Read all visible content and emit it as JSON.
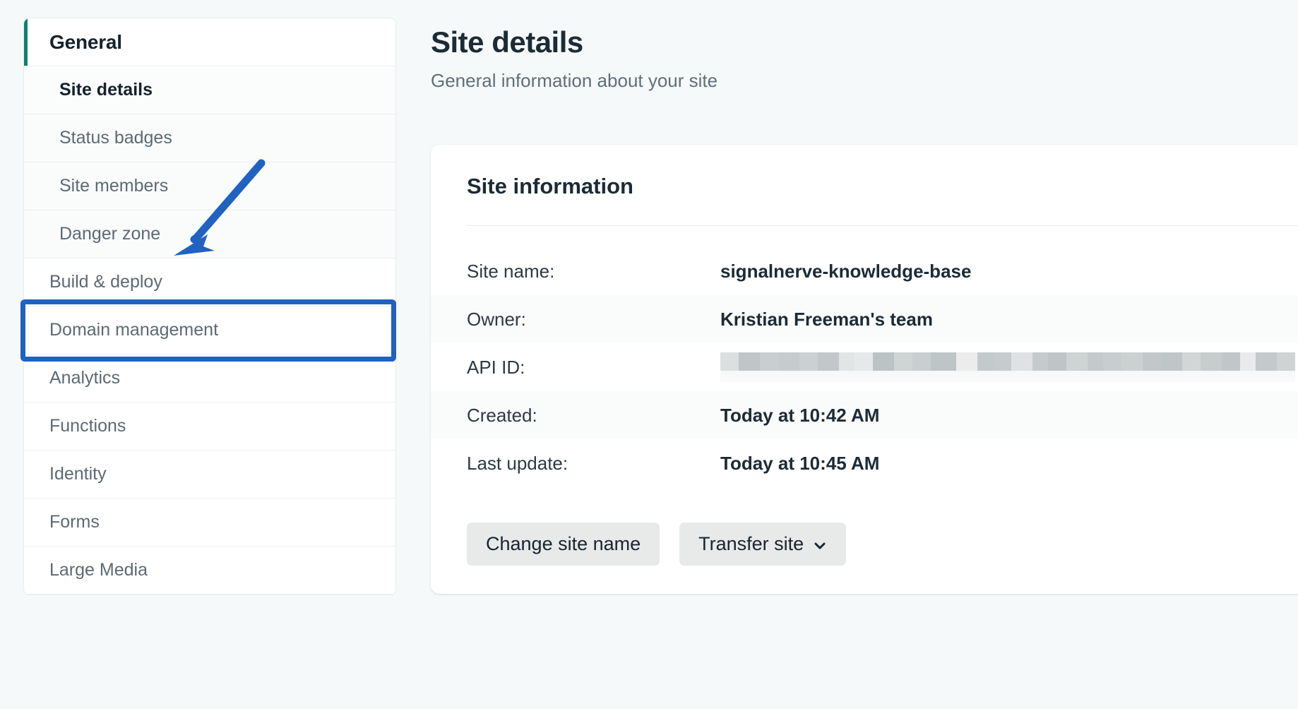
{
  "sidebar": {
    "header": {
      "label": "General",
      "accent_color": "#0e806f"
    },
    "subitems": [
      {
        "label": "Site details",
        "active": true
      },
      {
        "label": "Status badges",
        "active": false
      },
      {
        "label": "Site members",
        "active": false
      },
      {
        "label": "Danger zone",
        "active": false
      }
    ],
    "items": [
      {
        "label": "Build & deploy",
        "highlighted": true
      },
      {
        "label": "Domain management",
        "highlighted": false
      },
      {
        "label": "Analytics",
        "highlighted": false
      },
      {
        "label": "Functions",
        "highlighted": false
      },
      {
        "label": "Identity",
        "highlighted": false
      },
      {
        "label": "Forms",
        "highlighted": false
      },
      {
        "label": "Large Media",
        "highlighted": false
      }
    ]
  },
  "annotation": {
    "highlight_color": "#1f62c0",
    "arrow_color": "#1f62c0",
    "target": "Build & deploy"
  },
  "main": {
    "title": "Site details",
    "subtitle": "General information about your site",
    "card": {
      "title": "Site information",
      "rows": [
        {
          "key": "Site name:",
          "value": "signalnerve-knowledge-base",
          "redacted": false
        },
        {
          "key": "Owner:",
          "value": "Kristian Freeman's team",
          "redacted": false
        },
        {
          "key": "API ID:",
          "value": "",
          "redacted": true
        },
        {
          "key": "Created:",
          "value": "Today at 10:42 AM",
          "redacted": false
        },
        {
          "key": "Last update:",
          "value": "Today at 10:45 AM",
          "redacted": false
        }
      ],
      "buttons": [
        {
          "label": "Change site name",
          "has_chevron": false
        },
        {
          "label": "Transfer site",
          "has_chevron": true
        }
      ]
    }
  }
}
